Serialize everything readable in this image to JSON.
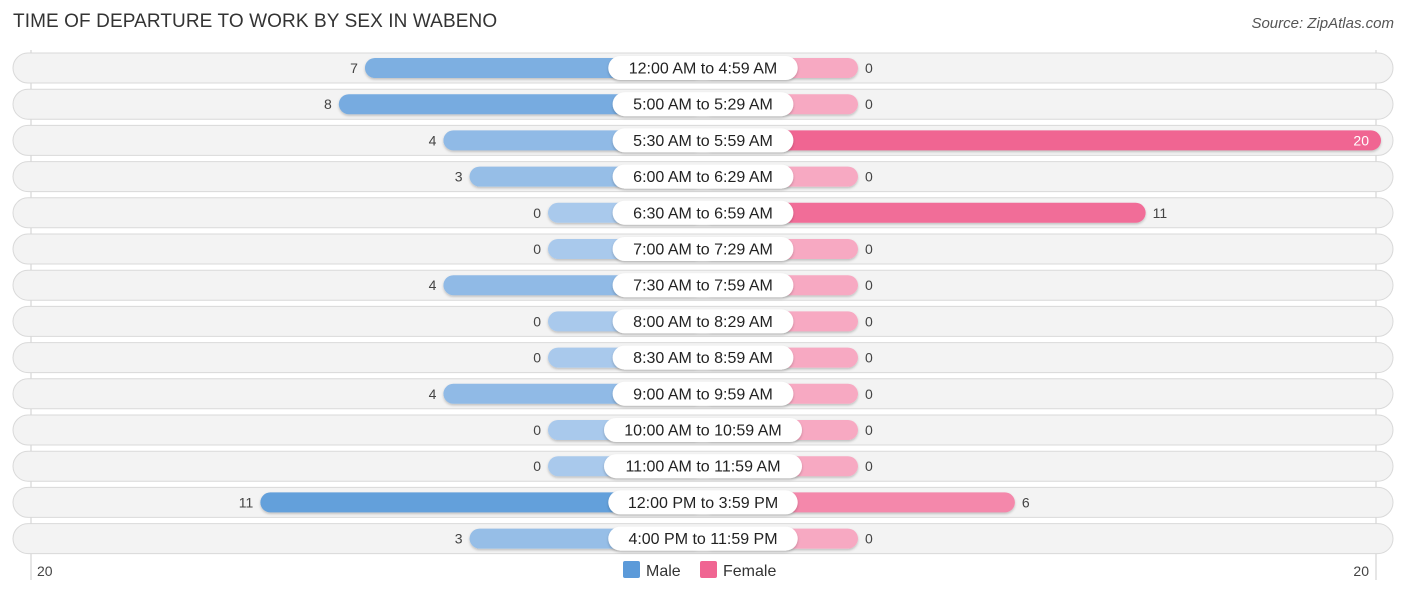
{
  "header": {
    "title": "TIME OF DEPARTURE TO WORK BY SEX IN WABENO",
    "source": "Source: ZipAtlas.com"
  },
  "colors": {
    "male_strong": "#5b9ad9",
    "male_light": "#a9c9ec",
    "female_strong": "#f06592",
    "female_light": "#f7a9c2",
    "row_bg": "#f3f3f3"
  },
  "chart_data": {
    "type": "bar",
    "orientation": "horizontal-diverging",
    "title": "TIME OF DEPARTURE TO WORK BY SEX IN WABENO",
    "categories": [
      "12:00 AM to 4:59 AM",
      "5:00 AM to 5:29 AM",
      "5:30 AM to 5:59 AM",
      "6:00 AM to 6:29 AM",
      "6:30 AM to 6:59 AM",
      "7:00 AM to 7:29 AM",
      "7:30 AM to 7:59 AM",
      "8:00 AM to 8:29 AM",
      "8:30 AM to 8:59 AM",
      "9:00 AM to 9:59 AM",
      "10:00 AM to 10:59 AM",
      "11:00 AM to 11:59 AM",
      "12:00 PM to 3:59 PM",
      "4:00 PM to 11:59 PM"
    ],
    "series": [
      {
        "name": "Male",
        "values": [
          7,
          8,
          4,
          3,
          0,
          0,
          4,
          0,
          0,
          4,
          0,
          0,
          11,
          3
        ]
      },
      {
        "name": "Female",
        "values": [
          0,
          0,
          20,
          0,
          11,
          0,
          0,
          0,
          0,
          0,
          0,
          0,
          6,
          0
        ]
      }
    ],
    "axis": {
      "left_label": "20",
      "right_label": "20",
      "max": 20
    },
    "legend": {
      "position": "bottom-center",
      "items": [
        "Male",
        "Female"
      ]
    },
    "xlabel": "",
    "ylabel": ""
  }
}
